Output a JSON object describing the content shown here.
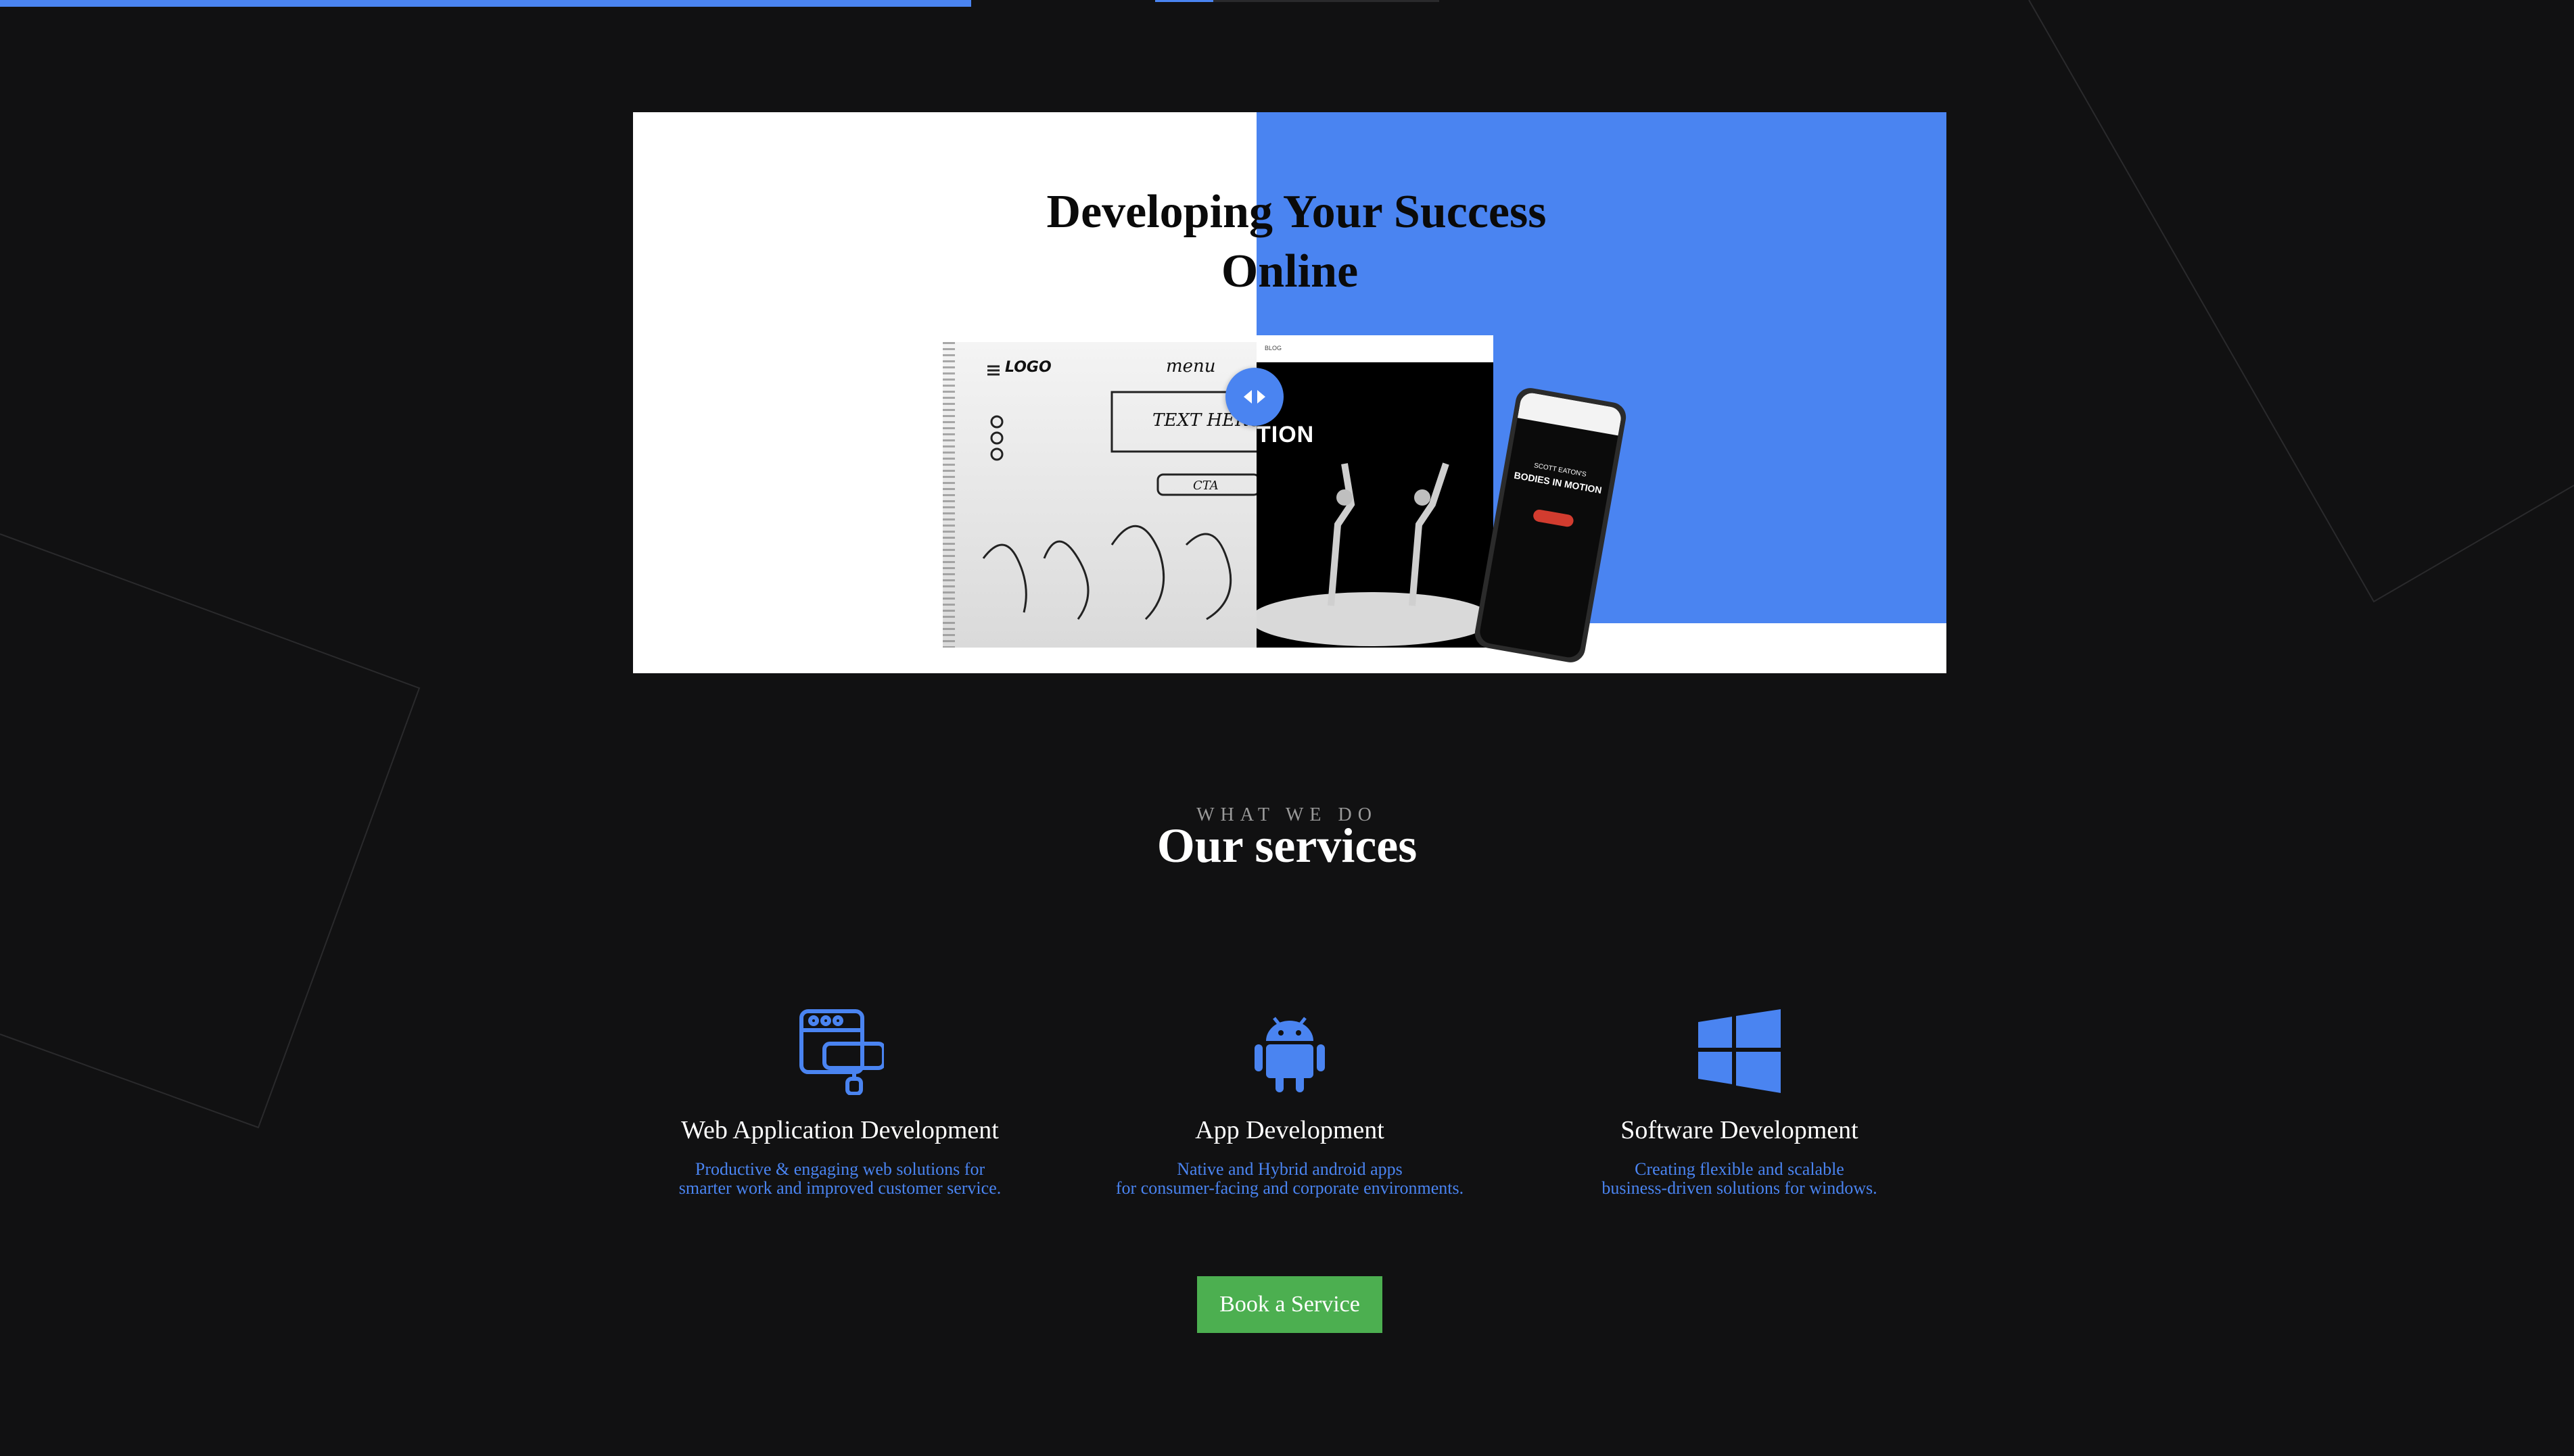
{
  "colors": {
    "accent": "#4a84f1",
    "background": "#111112",
    "cta": "#4caf50"
  },
  "hero": {
    "title_line1": "Developing Your Success",
    "title_line2": "Online",
    "mockup": {
      "sketch_text": "TEXT HERO",
      "motion_text": "TION",
      "phone_name": "SCOTT EATON'S",
      "phone_title": "BODIES IN MOTION"
    }
  },
  "services_section": {
    "eyebrow": "WHAT WE DO",
    "title": "Our services",
    "items": [
      {
        "icon": "web-development-icon",
        "title": "Web Application Development",
        "desc_line1": "Productive & engaging web solutions for",
        "desc_line2": "smarter work and improved customer service."
      },
      {
        "icon": "android-icon",
        "title": "App Development",
        "desc_line1": "Native and Hybrid android apps",
        "desc_line2": "for consumer-facing and corporate environments."
      },
      {
        "icon": "windows-icon",
        "title": "Software Development",
        "desc_line1": "Creating flexible and scalable",
        "desc_line2": "business-driven solutions for windows."
      }
    ]
  },
  "cta": {
    "label": "Book a Service"
  }
}
